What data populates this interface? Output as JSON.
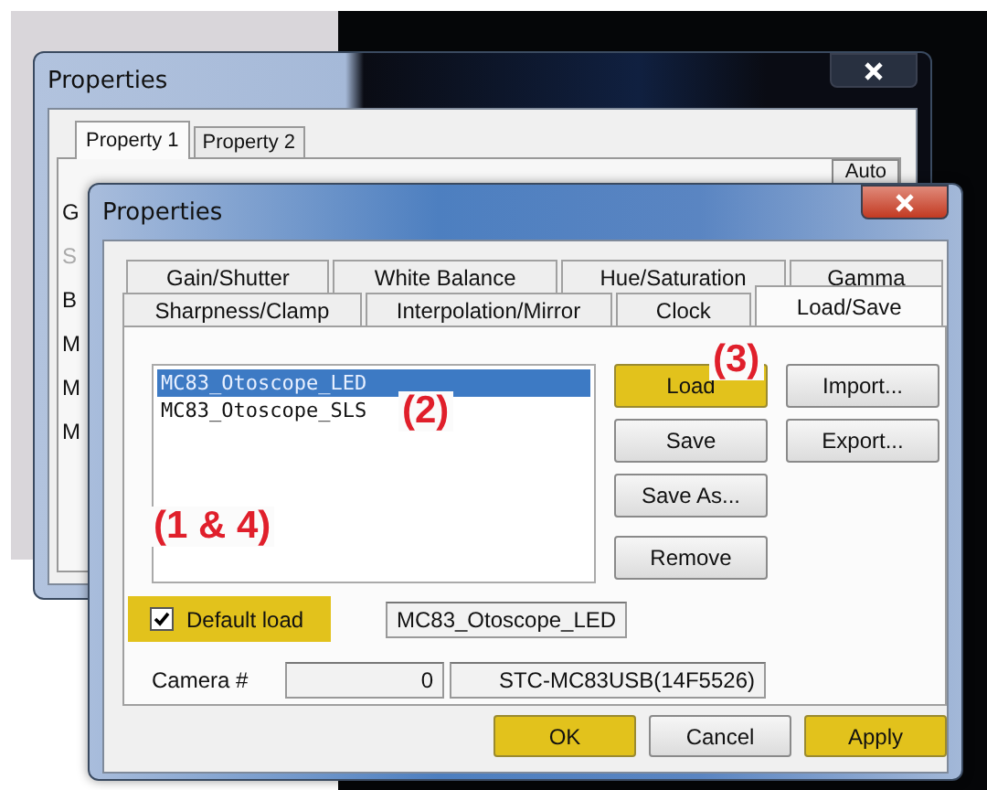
{
  "back_window": {
    "title": "Properties",
    "tabs": [
      {
        "label": "Property 1",
        "selected": true
      },
      {
        "label": "Property 2",
        "selected": false
      }
    ],
    "auto_button": "Auto",
    "cut_labels": [
      {
        "text": "G",
        "disabled": false
      },
      {
        "text": "S",
        "disabled": true
      },
      {
        "text": "B",
        "disabled": false
      },
      {
        "text": "M",
        "disabled": false
      },
      {
        "text": "M",
        "disabled": false
      },
      {
        "text": "M",
        "disabled": false
      }
    ]
  },
  "window": {
    "title": "Properties",
    "tab_rows": [
      [
        {
          "label": "Gain/Shutter",
          "selected": false
        },
        {
          "label": "White Balance",
          "selected": false
        },
        {
          "label": "Hue/Saturation",
          "selected": false
        },
        {
          "label": "Gamma",
          "selected": false
        }
      ],
      [
        {
          "label": "Sharpness/Clamp",
          "selected": false
        },
        {
          "label": "Interpolation/Mirror",
          "selected": false
        },
        {
          "label": "Clock",
          "selected": false
        },
        {
          "label": "Load/Save",
          "selected": true
        }
      ]
    ],
    "profiles": [
      {
        "name": "MC83_Otoscope_LED",
        "selected": true
      },
      {
        "name": "MC83_Otoscope_SLS",
        "selected": false
      }
    ],
    "side_buttons": [
      {
        "label": "Load",
        "highlighted": true
      },
      {
        "label": "Save",
        "highlighted": false
      },
      {
        "label": "Save As...",
        "highlighted": false
      },
      {
        "label": "Remove",
        "highlighted": false
      }
    ],
    "file_buttons": [
      {
        "label": "Import...",
        "highlighted": false
      },
      {
        "label": "Export...",
        "highlighted": false
      }
    ],
    "default_load": {
      "label": "Default load",
      "checked": true,
      "highlighted": true
    },
    "default_profile": "MC83_Otoscope_LED",
    "camera": {
      "label": "Camera #",
      "number": "0",
      "model": "STC-MC83USB(14F5526)"
    },
    "footer_buttons": [
      {
        "label": "OK",
        "highlighted": true
      },
      {
        "label": "Cancel",
        "highlighted": false
      },
      {
        "label": "Apply",
        "highlighted": true
      }
    ]
  },
  "annotations": [
    {
      "text": "(2)"
    },
    {
      "text": "(3)"
    },
    {
      "text": "(1 & 4)"
    }
  ]
}
